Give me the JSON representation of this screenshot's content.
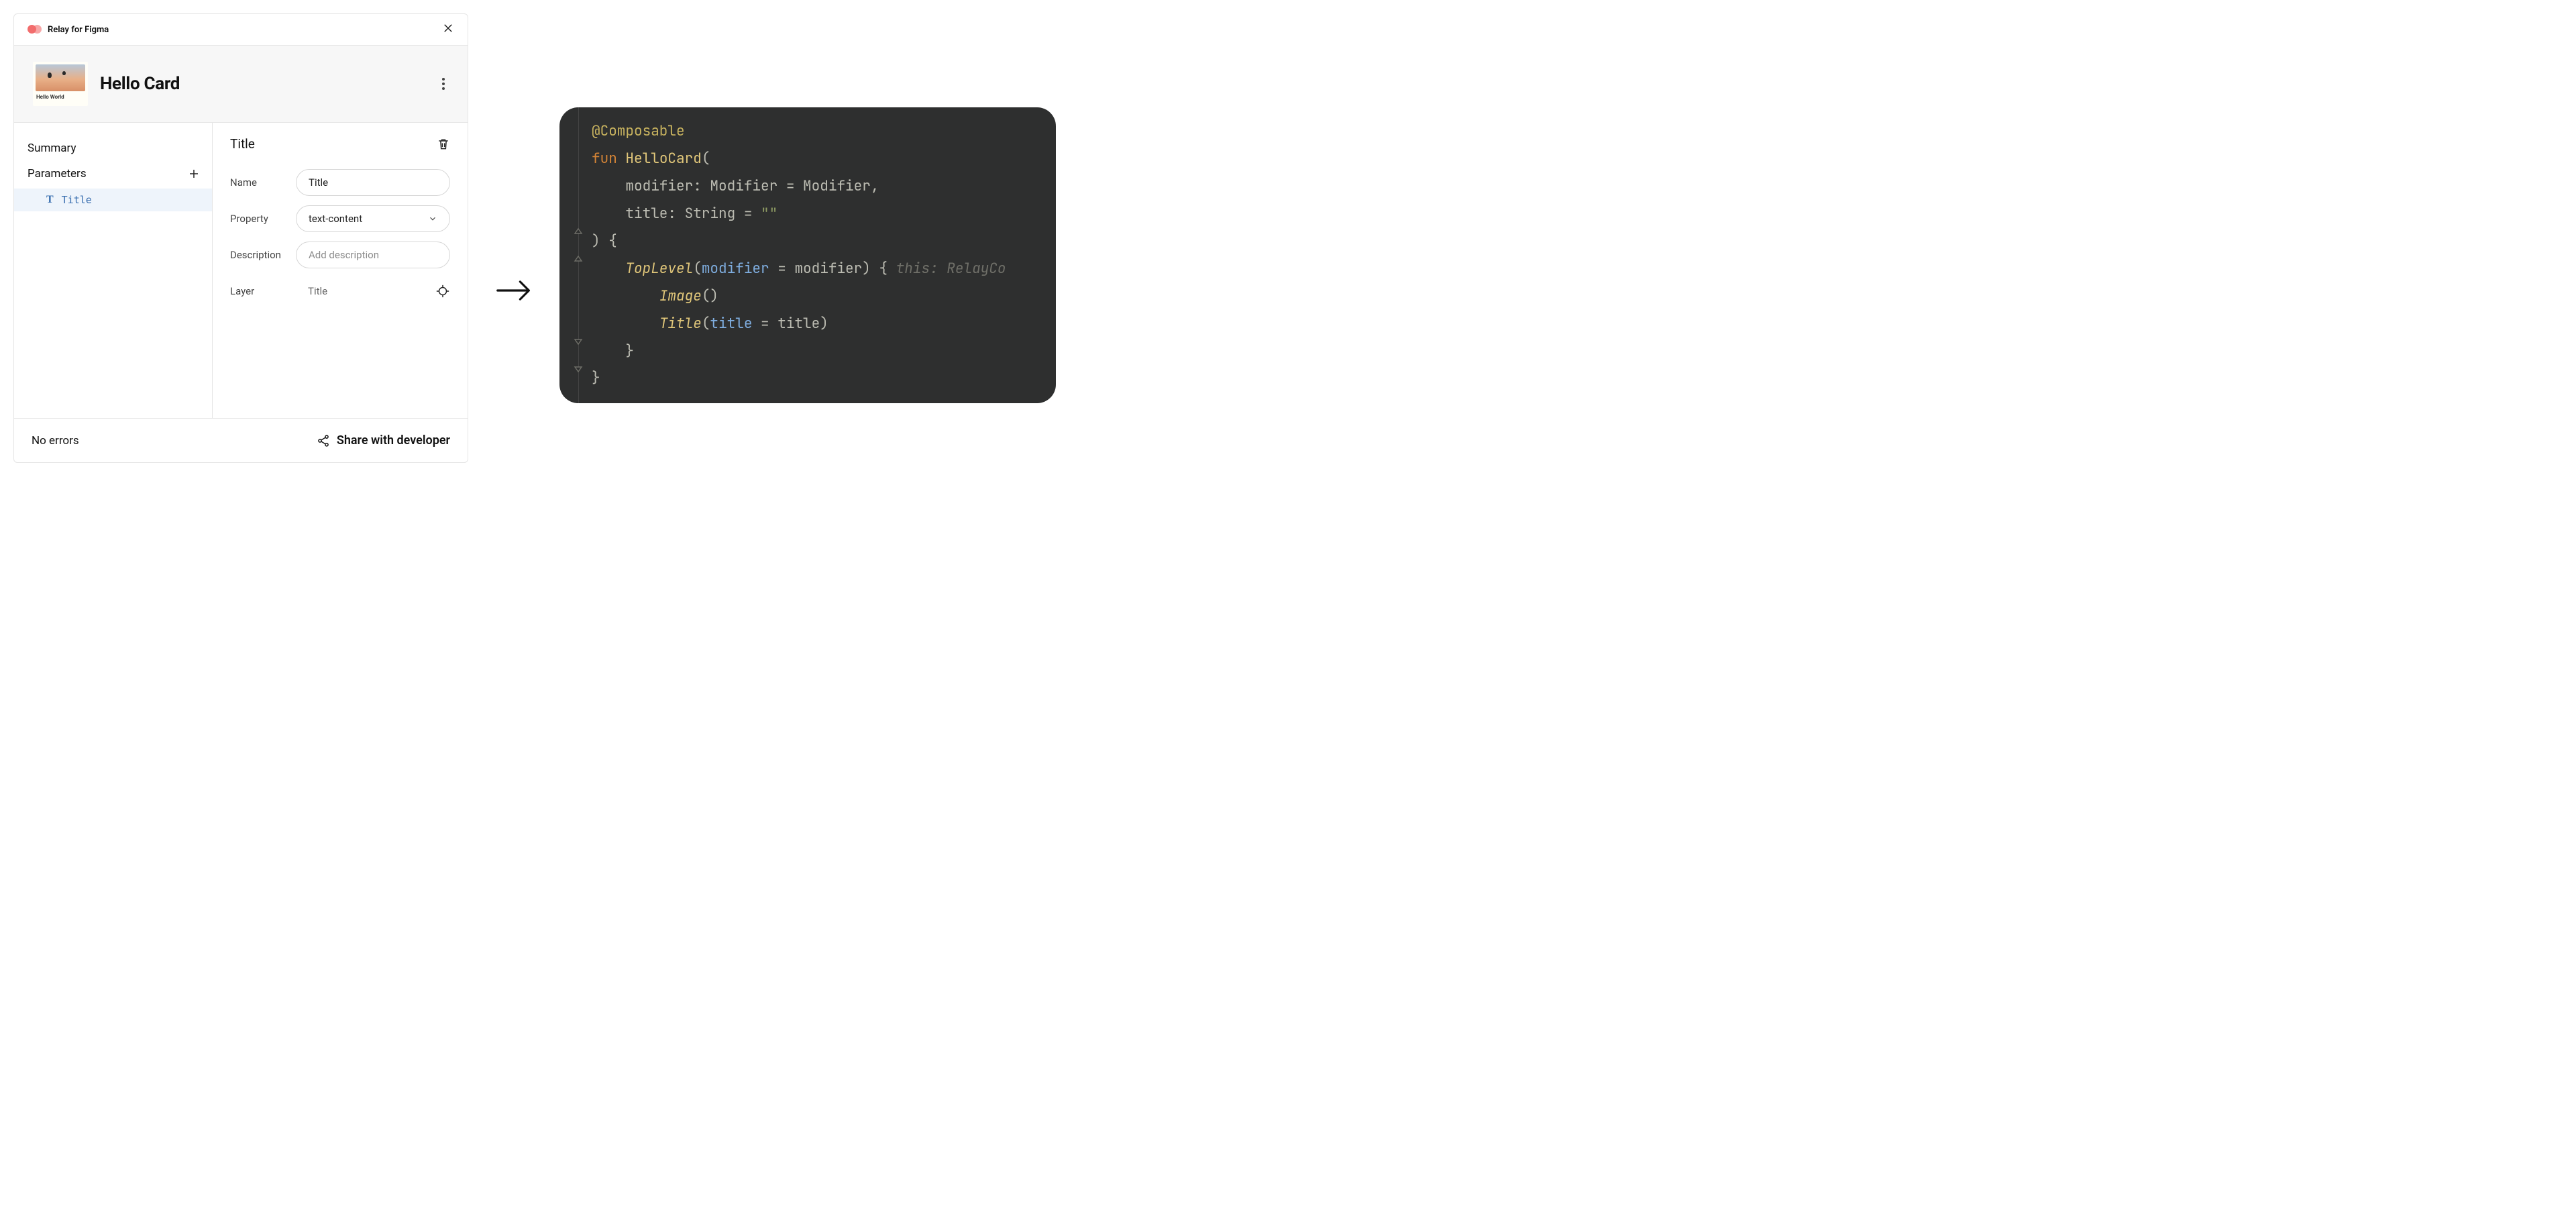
{
  "plugin": {
    "brand_name": "Relay for Figma",
    "card_title": "Hello Card",
    "thumb_caption": "Hello World",
    "footer_status": "No errors",
    "share_label": "Share with developer"
  },
  "sidebar": {
    "summary_label": "Summary",
    "parameters_label": "Parameters",
    "items": [
      {
        "icon": "T",
        "label": "Title"
      }
    ]
  },
  "detail": {
    "title": "Title",
    "fields": {
      "name": {
        "label": "Name",
        "value": "Title"
      },
      "property": {
        "label": "Property",
        "value": "text-content"
      },
      "description": {
        "label": "Description",
        "placeholder": "Add description"
      },
      "layer": {
        "label": "Layer",
        "value": "Title"
      }
    }
  },
  "code": {
    "tokens": {
      "annotation": "@Composable",
      "fun": "fun",
      "fn_name": "HelloCard",
      "p_modifier": "modifier",
      "t_modifier": "Modifier",
      "p_title": "title",
      "t_string": "String",
      "str_empty": "\"\"",
      "fn_toplevel": "TopLevel",
      "fn_image": "Image",
      "fn_title": "Title",
      "hint_lambda": "this: RelayCo"
    }
  }
}
